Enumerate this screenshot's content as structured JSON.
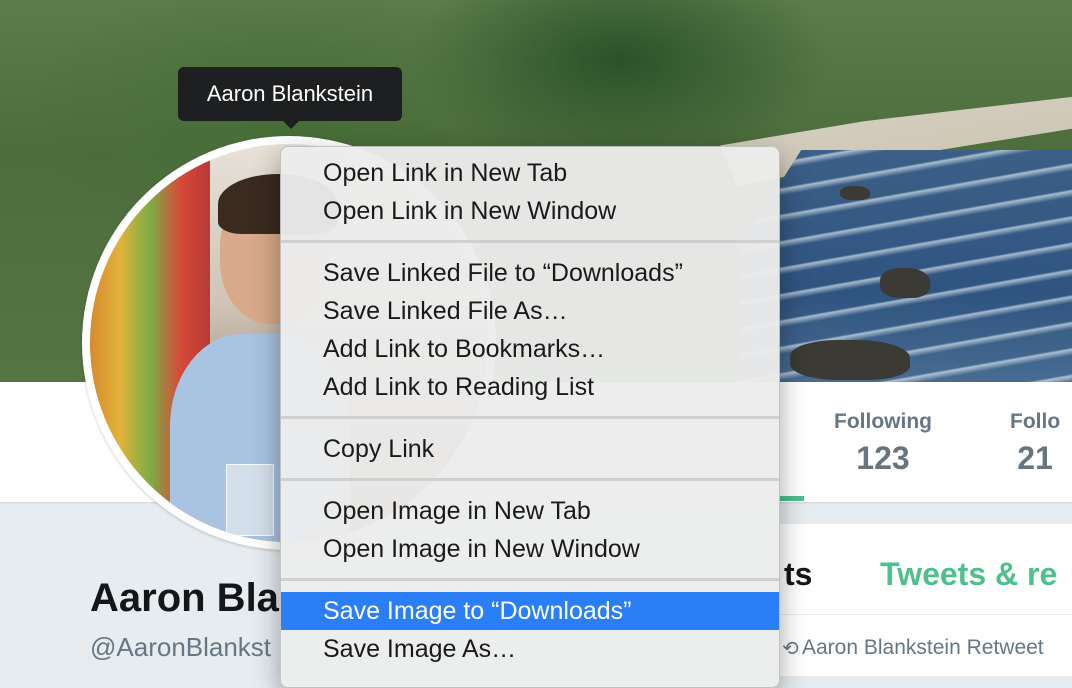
{
  "tooltip": {
    "text": "Aaron Blankstein"
  },
  "profile": {
    "name_visible": "Aaron Bla",
    "handle_visible": "@AaronBlankst",
    "stats": [
      {
        "label": "Following",
        "value": "123"
      },
      {
        "label": "Follo",
        "value": "21"
      }
    ]
  },
  "timeline": {
    "tabs": [
      {
        "label": "ts"
      },
      {
        "label": "Tweets & re"
      }
    ],
    "retweet_text": "Aaron Blankstein Retweet"
  },
  "context_menu": {
    "items": [
      {
        "label": "Open Link in New Tab"
      },
      {
        "label": "Open Link in New Window"
      },
      {
        "label": "Save Linked File to “Downloads”"
      },
      {
        "label": "Save Linked File As…"
      },
      {
        "label": "Add Link to Bookmarks…"
      },
      {
        "label": "Add Link to Reading List"
      },
      {
        "label": "Copy Link"
      },
      {
        "label": "Open Image in New Tab"
      },
      {
        "label": "Open Image in New Window"
      },
      {
        "label": "Save Image to “Downloads”"
      },
      {
        "label": "Save Image As…"
      }
    ],
    "selected_index": 9,
    "selection_color": "#2a7ff6"
  },
  "colors": {
    "accent_green": "#4fc08d",
    "text_gray": "#657786"
  }
}
